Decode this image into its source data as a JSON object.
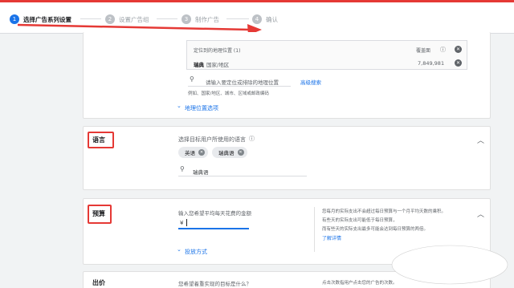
{
  "steps": [
    {
      "num": "1",
      "label": "选择广告系列设置"
    },
    {
      "num": "2",
      "label": "设置广告组"
    },
    {
      "num": "3",
      "label": "制作广告"
    },
    {
      "num": "4",
      "label": "确认"
    }
  ],
  "location": {
    "header_label": "定位到的地理位置 (1)",
    "reach_label": "覆盖面",
    "row_name": "瑞典",
    "row_type": "国家/地区",
    "row_reach": "7,849,981",
    "search_placeholder": "请输入要定位或排除的地理位置",
    "advanced_search": "高级搜索",
    "hint": "例如、国家/地区、城市、区域或邮政编码",
    "options_link": "地理位置选项"
  },
  "language": {
    "title": "语言",
    "prompt": "选择目标用户所使用的语言",
    "chips": [
      "英语",
      "瑞典语"
    ],
    "search_value": "瑞典语"
  },
  "budget": {
    "title": "预算",
    "prompt": "输入您希望平均每天花费的金额",
    "currency": "¥",
    "help1": "您每月的实际支出不会超过每日预算与一个月平均天数的乘积。",
    "help2": "有些天的实际支出可能低于每日预算，",
    "help3": "而有些天的实际支出最多可能会达到每日预算的两倍。",
    "learn_more": "了解详情",
    "delivery_link": "投放方式"
  },
  "bidding": {
    "title": "出价",
    "prompt": "您希望着重实现的目标是什么？",
    "help": "点击次数指用户点击您的广告的次数。"
  },
  "colors": {
    "accent": "#1a73e8",
    "annotation": "#e53935"
  }
}
